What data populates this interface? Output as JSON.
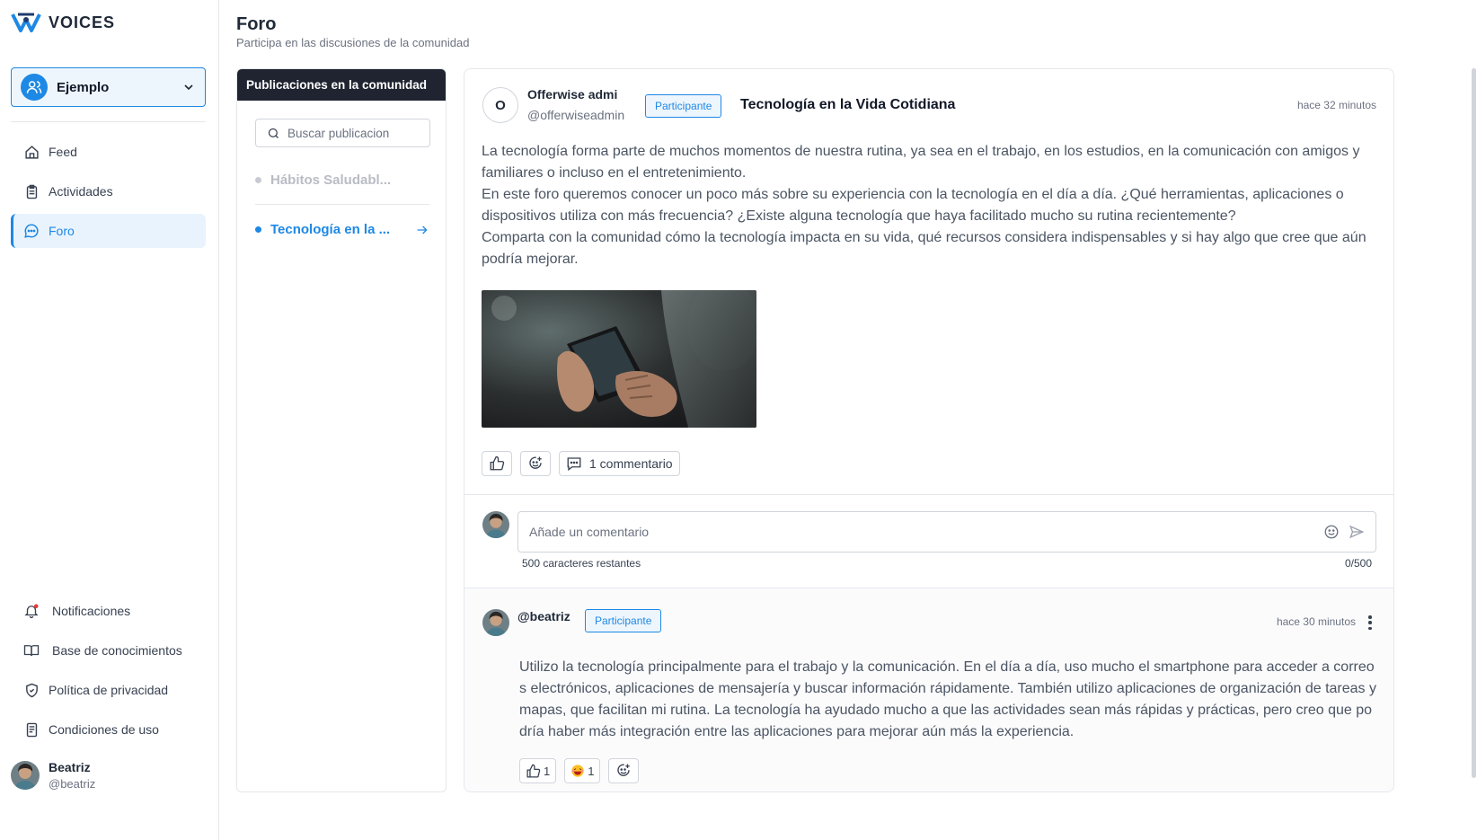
{
  "app": {
    "logo_text": "VOICES",
    "accent_color": "#1e88e5",
    "community_selector": {
      "value": "Ejemplo"
    }
  },
  "sidebar": {
    "items": [
      {
        "label": "Feed",
        "icon": "home-icon"
      },
      {
        "label": "Actividades",
        "icon": "clipboard-icon"
      },
      {
        "label": "Foro",
        "icon": "chat-icon",
        "active": true
      }
    ],
    "bottom_items": [
      {
        "label": "Notificaciones",
        "icon": "bell-icon",
        "has_dot": true
      },
      {
        "label": "Base de conocimientos",
        "icon": "book-icon"
      },
      {
        "label": "Política de privacidad",
        "icon": "shield-icon"
      },
      {
        "label": "Condiciones de uso",
        "icon": "document-icon"
      }
    ],
    "user": {
      "name": "Beatriz",
      "handle": "@beatriz"
    }
  },
  "header": {
    "title": "Foro",
    "subtitle": "Participa en las discusiones de la comunidad"
  },
  "posts_panel": {
    "title": "Publicaciones en la comunidad",
    "search_placeholder": "Buscar publicacion",
    "posts": [
      {
        "label": "Hábitos Saludabl...",
        "active": false
      },
      {
        "label": "Tecnología en la ...",
        "active": true
      }
    ]
  },
  "post": {
    "author_initial": "O",
    "author_name": "Offerwise admi",
    "author_handle": "@offerwiseadmin",
    "badge": "Participante",
    "title": "Tecnología en la Vida Cotidiana",
    "time": "hace 32 minutos",
    "paragraphs": [
      "La tecnología forma parte de muchos momentos de nuestra rutina, ya sea en el trabajo, en los estudios, en la comunicación con amigos y familiares o incluso en el entretenimiento.",
      "En este foro queremos conocer un poco más sobre su experiencia con la tecnología en el día a día. ¿Qué herramientas, aplicaciones o dispositivos utiliza con más frecuencia? ¿Existe alguna tecnología que haya facilitado mucho su rutina recientemente?",
      "Comparta con la comunidad cómo la tecnología impacta en su vida, qué recursos considera indispensables y si hay algo que cree que aún podría mejorar."
    ],
    "comments_button": "1 commentario"
  },
  "comment_box": {
    "placeholder": "Añade un comentario",
    "remaining": "500 caracteres restantes",
    "count": "0/500"
  },
  "comment": {
    "handle": "@beatriz",
    "badge": "Participante",
    "time": "hace 30 minutos",
    "text": "Utilizo la tecnología principalmente para el trabajo y la comunicación. En el día a día, uso mucho el smartphone para acceder a correos electrónicos, aplicaciones de mensajería y buscar información rápidamente. También utilizo aplicaciones de organización de tareas y mapas, que facilitan mi rutina. La tecnología ha ayudado mucho a que las actividades sean más rápidas y prácticas, pero creo que podría haber más integración entre las aplicaciones para mejorar aún más la experiencia.",
    "likes": "1",
    "reactions": "1"
  }
}
